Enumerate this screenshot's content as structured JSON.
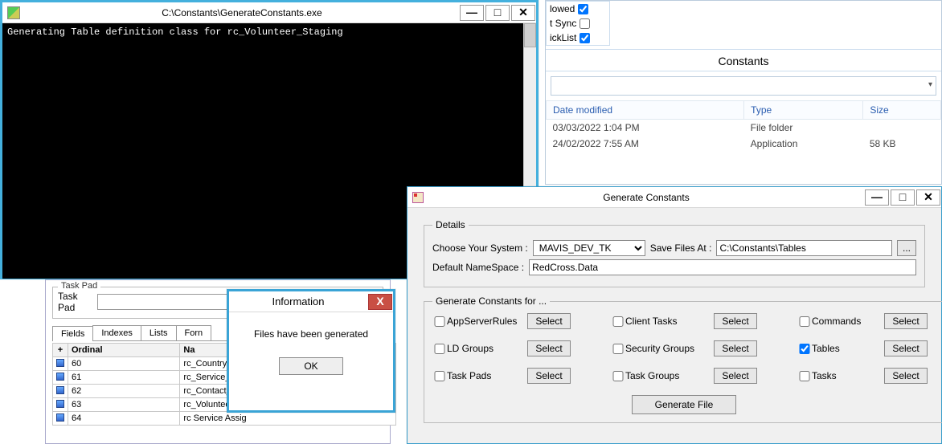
{
  "console": {
    "title": "C:\\Constants\\GenerateConstants.exe",
    "output": "Generating Table definition class for rc_Volunteer_Staging"
  },
  "explorer": {
    "title": "Constants",
    "checks": [
      {
        "label": "lowed",
        "checked": true
      },
      {
        "label": "t Sync",
        "checked": false
      },
      {
        "label": "ickList",
        "checked": true
      }
    ],
    "columns": [
      "Date modified",
      "Type",
      "Size"
    ],
    "rows": [
      {
        "date": "03/03/2022 1:04 PM",
        "type": "File folder",
        "size": ""
      },
      {
        "date": "24/02/2022 7:55 AM",
        "type": "Application",
        "size": "58 KB"
      }
    ]
  },
  "bglist": {
    "taskpad_caption": "Task Pad",
    "taskpad_label": "Task Pad",
    "tabs": [
      "Fields",
      "Indexes",
      "Lists",
      "Forn"
    ],
    "columns": [
      "",
      "Ordinal",
      "Na"
    ],
    "plus": "+",
    "rows": [
      {
        "ord": "60",
        "name": "rc_Country_of_B"
      },
      {
        "ord": "61",
        "name": "rc_Service_Id"
      },
      {
        "ord": "62",
        "name": "rc_Contact_Id"
      },
      {
        "ord": "63",
        "name": "rc_Volunteer_Id"
      },
      {
        "ord": "64",
        "name": "rc Service Assig"
      }
    ]
  },
  "info": {
    "title": "Information",
    "message": "Files have been generated",
    "ok": "OK"
  },
  "gen": {
    "title": "Generate Constants",
    "details_legend": "Details",
    "choose_label": "Choose Your System :",
    "system": "MAVIS_DEV_TK",
    "save_label": "Save Files At :",
    "save_path": "C:\\Constants\\Tables",
    "browse": "...",
    "ns_label": "Default NameSpace :",
    "ns": "RedCross.Data",
    "for_legend": "Generate Constants for ...",
    "select": "Select",
    "items": [
      {
        "label": "AppServerRules",
        "checked": false
      },
      {
        "label": "Client Tasks",
        "checked": false
      },
      {
        "label": "Commands",
        "checked": false
      },
      {
        "label": "LD Groups",
        "checked": false
      },
      {
        "label": "Security Groups",
        "checked": false
      },
      {
        "label": "Tables",
        "checked": true
      },
      {
        "label": "Task Pads",
        "checked": false
      },
      {
        "label": "Task Groups",
        "checked": false
      },
      {
        "label": "Tasks",
        "checked": false
      }
    ],
    "generate": "Generate File"
  },
  "win_controls": {
    "min": "—",
    "max": "□",
    "close": "✕",
    "close_x": "X"
  }
}
